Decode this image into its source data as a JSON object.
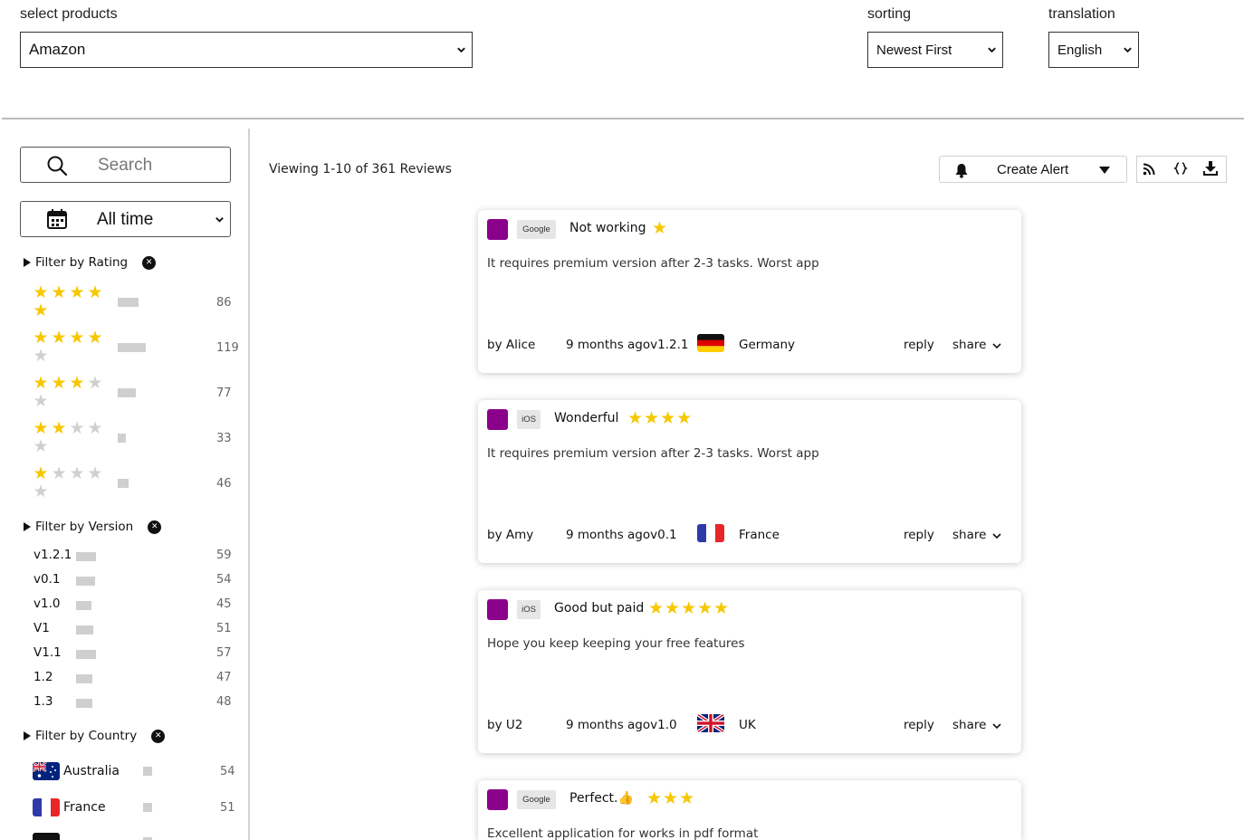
{
  "top": {
    "products_label": "select products",
    "products_value": "Amazon",
    "sorting_label": "sorting",
    "sorting_value": "Newest First",
    "translation_label": "translation",
    "translation_value": "English"
  },
  "sidebar": {
    "search_placeholder": "Search",
    "date_range": "All time",
    "rating_filter": {
      "title": "Filter by Rating",
      "rows": [
        {
          "stars": 5,
          "count": "86",
          "fraction": 0.72
        },
        {
          "stars": 4,
          "count": "119",
          "fraction": 1.0
        },
        {
          "stars": 3,
          "count": "77",
          "fraction": 0.65
        },
        {
          "stars": 2,
          "count": "33",
          "fraction": 0.28
        },
        {
          "stars": 1,
          "count": "46",
          "fraction": 0.39
        }
      ]
    },
    "version_filter": {
      "title": "Filter by Version",
      "rows": [
        {
          "label": "v1.2.1",
          "count": "59"
        },
        {
          "label": "v0.1",
          "count": "54"
        },
        {
          "label": "v1.0",
          "count": "45"
        },
        {
          "label": "V1",
          "count": "51"
        },
        {
          "label": "V1.1",
          "count": "57"
        },
        {
          "label": "1.2",
          "count": "47"
        },
        {
          "label": "1.3",
          "count": "48"
        }
      ]
    },
    "country_filter": {
      "title": "Filter by Country",
      "rows": [
        {
          "label": "Australia",
          "count": "54",
          "flag": "australia-flag"
        },
        {
          "label": "France",
          "count": "51",
          "flag": "france-flag"
        }
      ]
    }
  },
  "main": {
    "viewing_text": "Viewing 1-10 of 361 Reviews",
    "create_alert_label": "Create Alert",
    "accent_color": "#8b008b",
    "star_color": "#f6c800",
    "reviews": [
      {
        "source": "Google",
        "title": "Not working",
        "stars": 1,
        "body": "It requires premium version after 2-3 tasks. Worst app",
        "author": "by Alice",
        "meta": "9 months agov1.2.1",
        "country": "Germany",
        "reply": "reply",
        "share": "share"
      },
      {
        "source": "iOS",
        "title": "Wonderful",
        "stars": 4,
        "body": "It requires premium version after 2-3 tasks. Worst app",
        "author": "by Amy",
        "meta": "9 months agov0.1",
        "country": "France",
        "reply": "reply",
        "share": "share"
      },
      {
        "source": "iOS",
        "title": "Good but paid",
        "stars": 5,
        "body": "Hope you keep keeping your free features",
        "author": "by U2",
        "meta": "9 months agov1.0",
        "country": "UK",
        "reply": "reply",
        "share": "share"
      },
      {
        "source": "Google",
        "title": "Perfect.👍",
        "stars": 3,
        "body": "Excellent application for works in pdf format",
        "author": "",
        "meta": "",
        "country": "",
        "reply": "",
        "share": ""
      }
    ]
  }
}
